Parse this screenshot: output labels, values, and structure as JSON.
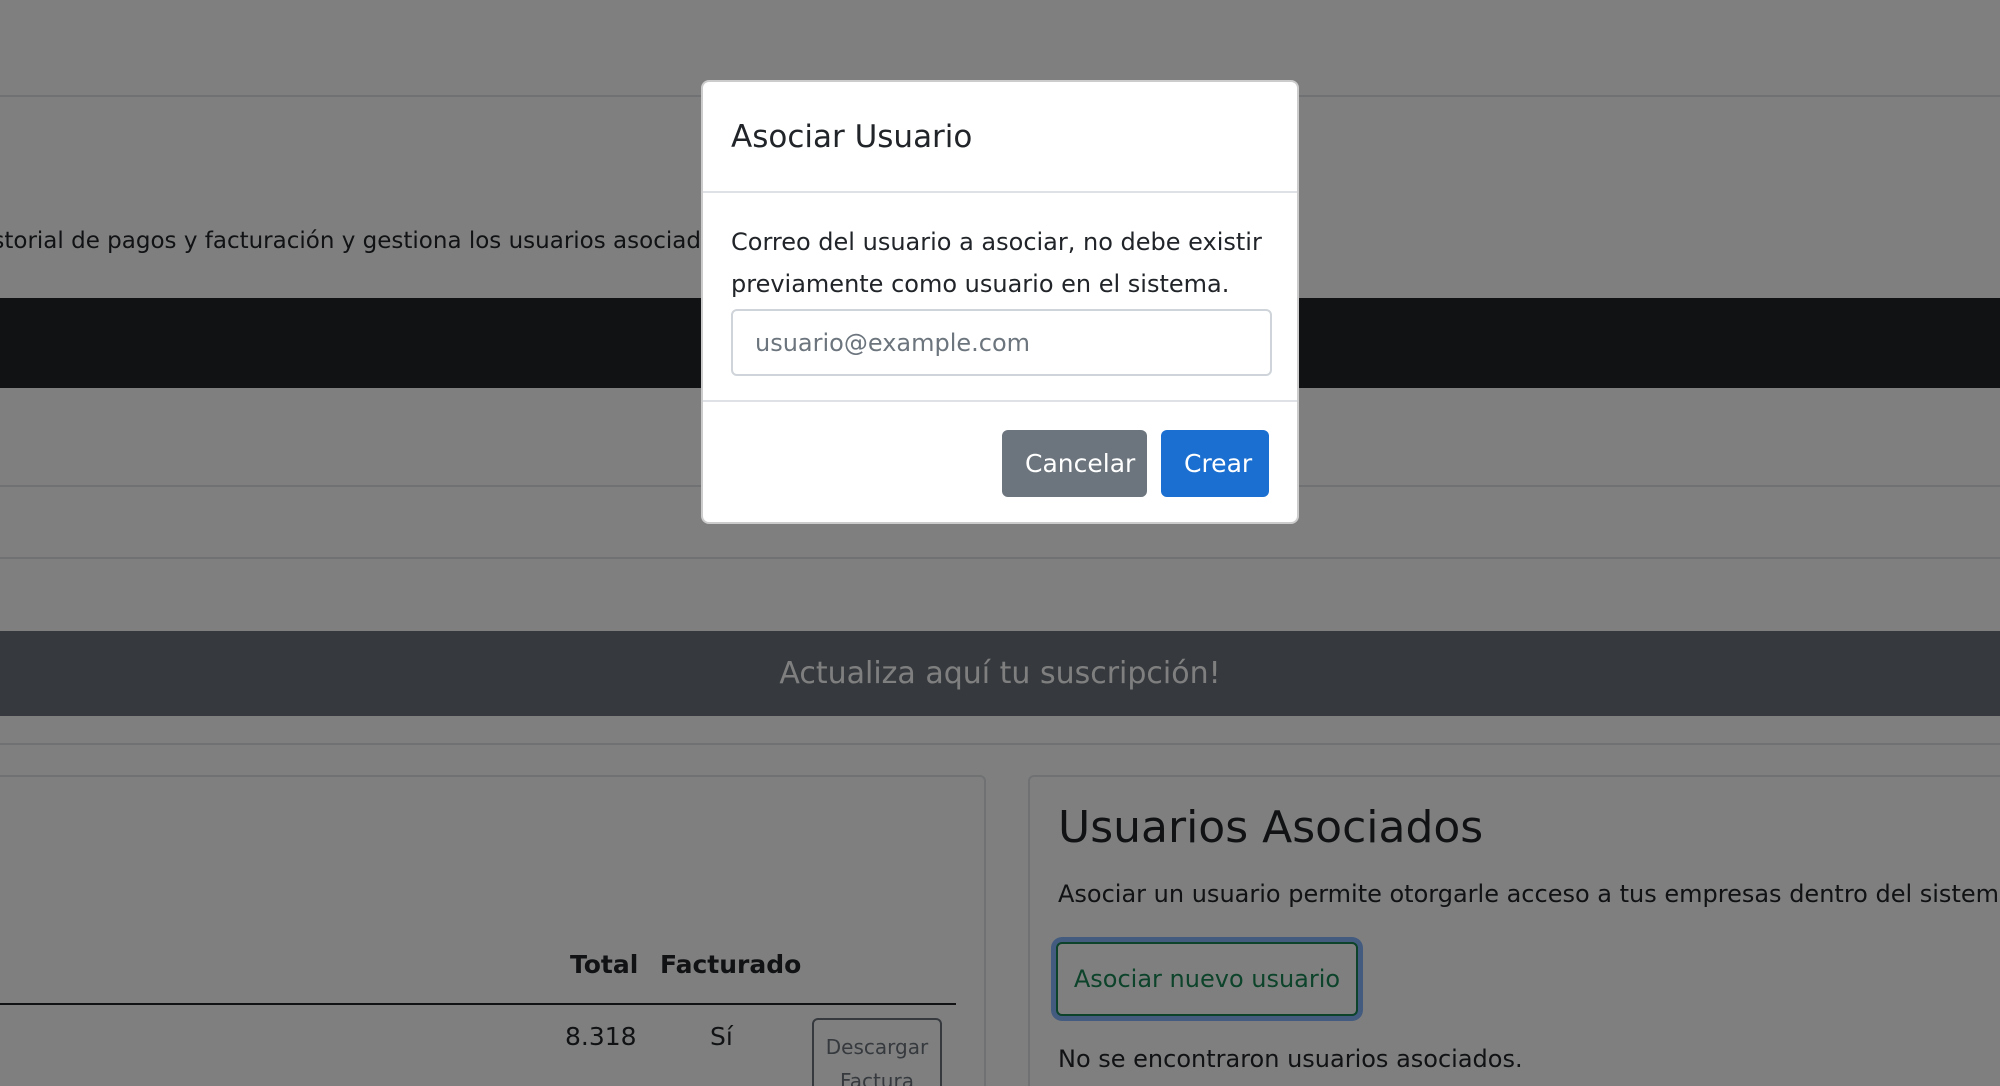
{
  "page": {
    "intro_text": "istorial de pagos y facturación y gestiona los usuarios asociados",
    "promo_banner": "Actualiza aquí tu suscripción!",
    "billing_table": {
      "headers": {
        "total": "Total",
        "facturado": "Facturado"
      },
      "rows": [
        {
          "total": "8.318",
          "facturado": "Sí",
          "action_line1": "Descargar",
          "action_line2": "Factura"
        }
      ]
    },
    "associated_users": {
      "title": "Usuarios Asociados",
      "description": "Asociar un usuario permite otorgarle acceso a tus empresas dentro del sistema.",
      "add_button": "Asociar nuevo usuario",
      "empty_message": "No se encontraron usuarios asociados."
    }
  },
  "modal": {
    "title": "Asociar Usuario",
    "label": "Correo del usuario a asociar, no debe existir previamente como usuario en el sistema.",
    "email_value": "",
    "email_placeholder": "usuario@example.com",
    "cancel_label": "Cancelar",
    "create_label": "Crear"
  },
  "colors": {
    "primary": "#1a6fd1",
    "secondary": "#6c757d",
    "success": "#198754",
    "dark": "#212529"
  }
}
